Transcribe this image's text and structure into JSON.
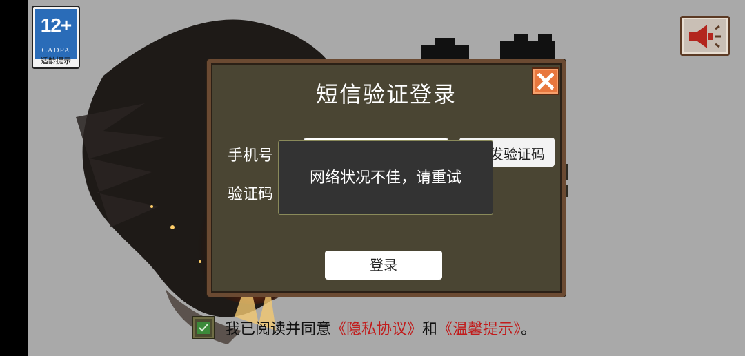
{
  "age_badge": {
    "rating": "12+",
    "org": "CADPA",
    "tip": "适龄提示"
  },
  "dialog": {
    "title": "短信验证登录",
    "phone_label": "手机号",
    "code_label": "验证码",
    "send_code_label": "发验证码",
    "login_label": "登录",
    "close_icon": "close-icon"
  },
  "toast": {
    "message": "网络状况不佳，请重试"
  },
  "agreement": {
    "checked": true,
    "prefix": "我已阅读并同意",
    "privacy_link": "《隐私协议》",
    "and": "和",
    "tips_link": "《温馨提示》",
    "suffix": "。"
  },
  "icons": {
    "speaker": "speaker-icon",
    "check": "check-icon"
  },
  "colors": {
    "dialog_bg": "#4a4533",
    "dialog_border": "#6b4a32",
    "close_bg": "#e8773e",
    "link": "#c11b1b",
    "checkbox_fill": "#3c8a3a"
  }
}
